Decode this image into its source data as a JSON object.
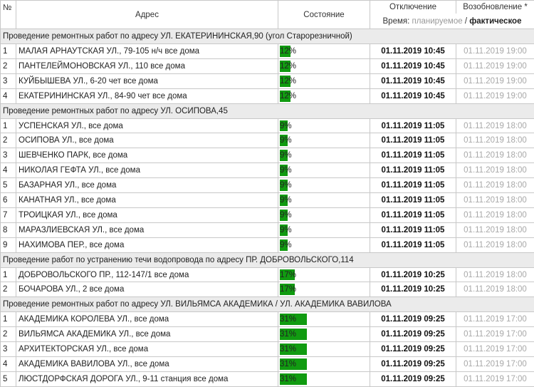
{
  "headers": {
    "num": "№",
    "address": "Адрес",
    "state": "Состояние",
    "off": "Отключение",
    "on": "Возобновление *",
    "time_label": "Время:",
    "time_planned": "планируемое",
    "time_sep": "/",
    "time_actual": "фактическое"
  },
  "groups": [
    {
      "title": "Проведение ремонтных работ по адресу УЛ. ЕКАТЕРИНИНСКАЯ,90 (угол Старорезничной)",
      "pct": 0.12,
      "pct_label": "12%",
      "off": "01.11.2019 10:45",
      "on": "01.11.2019 19:00",
      "rows": [
        {
          "n": "1",
          "addr": "МАЛАЯ АРНАУТСКАЯ УЛ., 79-105 н/ч все дома"
        },
        {
          "n": "2",
          "addr": "ПАНТЕЛЕЙМОНОВСКАЯ УЛ., 110 все дома"
        },
        {
          "n": "3",
          "addr": "КУЙБЫШЕВА УЛ., 6-20 чет все дома"
        },
        {
          "n": "4",
          "addr": "ЕКАТЕРИНИНСКАЯ УЛ., 84-90 чет все дома"
        }
      ]
    },
    {
      "title": "Проведение ремонтных работ по адресу УЛ. ОСИПОВА,45",
      "pct": 0.09,
      "pct_label": "9%",
      "off": "01.11.2019 11:05",
      "on": "01.11.2019 18:00",
      "rows": [
        {
          "n": "1",
          "addr": "УСПЕНСКАЯ УЛ., все дома"
        },
        {
          "n": "2",
          "addr": "ОСИПОВА УЛ., все дома"
        },
        {
          "n": "3",
          "addr": "ШЕВЧЕНКО ПАРК, все дома"
        },
        {
          "n": "4",
          "addr": "НИКОЛАЯ ГЕФТА УЛ., все дома"
        },
        {
          "n": "5",
          "addr": "БАЗАРНАЯ УЛ., все дома"
        },
        {
          "n": "6",
          "addr": "КАНАТНАЯ УЛ., все дома"
        },
        {
          "n": "7",
          "addr": "ТРОИЦКАЯ УЛ., все дома"
        },
        {
          "n": "8",
          "addr": "МАРАЗЛИЕВСКАЯ УЛ., все дома"
        },
        {
          "n": "9",
          "addr": "НАХИМОВА ПЕР., все дома"
        }
      ]
    },
    {
      "title": "Проведение работ по устранению течи водопровода по адресу ПР. ДОБРОВОЛЬСКОГО,114",
      "pct": 0.17,
      "pct_label": "17%",
      "off": "01.11.2019 10:25",
      "on": "01.11.2019 18:00",
      "rows": [
        {
          "n": "1",
          "addr": "ДОБРОВОЛЬСКОГО ПР., 112-147/1 все дома"
        },
        {
          "n": "2",
          "addr": "БОЧАРОВА УЛ., 2 все дома"
        }
      ]
    },
    {
      "title": "Проведение ремонтных работ по адресу УЛ. ВИЛЬЯМСА АКАДЕМИКА / УЛ. АКАДЕМИКА ВАВИЛОВА",
      "pct": 0.31,
      "pct_label": "31%",
      "off": "01.11.2019 09:25",
      "on": "01.11.2019 17:00",
      "rows": [
        {
          "n": "1",
          "addr": "АКАДЕМИКА КОРОЛЕВА УЛ., все дома"
        },
        {
          "n": "2",
          "addr": "ВИЛЬЯМСА АКАДЕМИКА УЛ., все дома"
        },
        {
          "n": "3",
          "addr": "АРХИТЕКТОРСКАЯ УЛ., все дома"
        },
        {
          "n": "4",
          "addr": "АКАДЕМИКА ВАВИЛОВА УЛ., все дома"
        },
        {
          "n": "5",
          "addr": "ЛЮСТДОРФСКАЯ ДОРОГА УЛ., 9-11 станция все дома"
        }
      ]
    }
  ],
  "colors": {
    "progress": "#119b11",
    "group_bg": "#ebebeb",
    "planned": "#a8a8a8"
  }
}
